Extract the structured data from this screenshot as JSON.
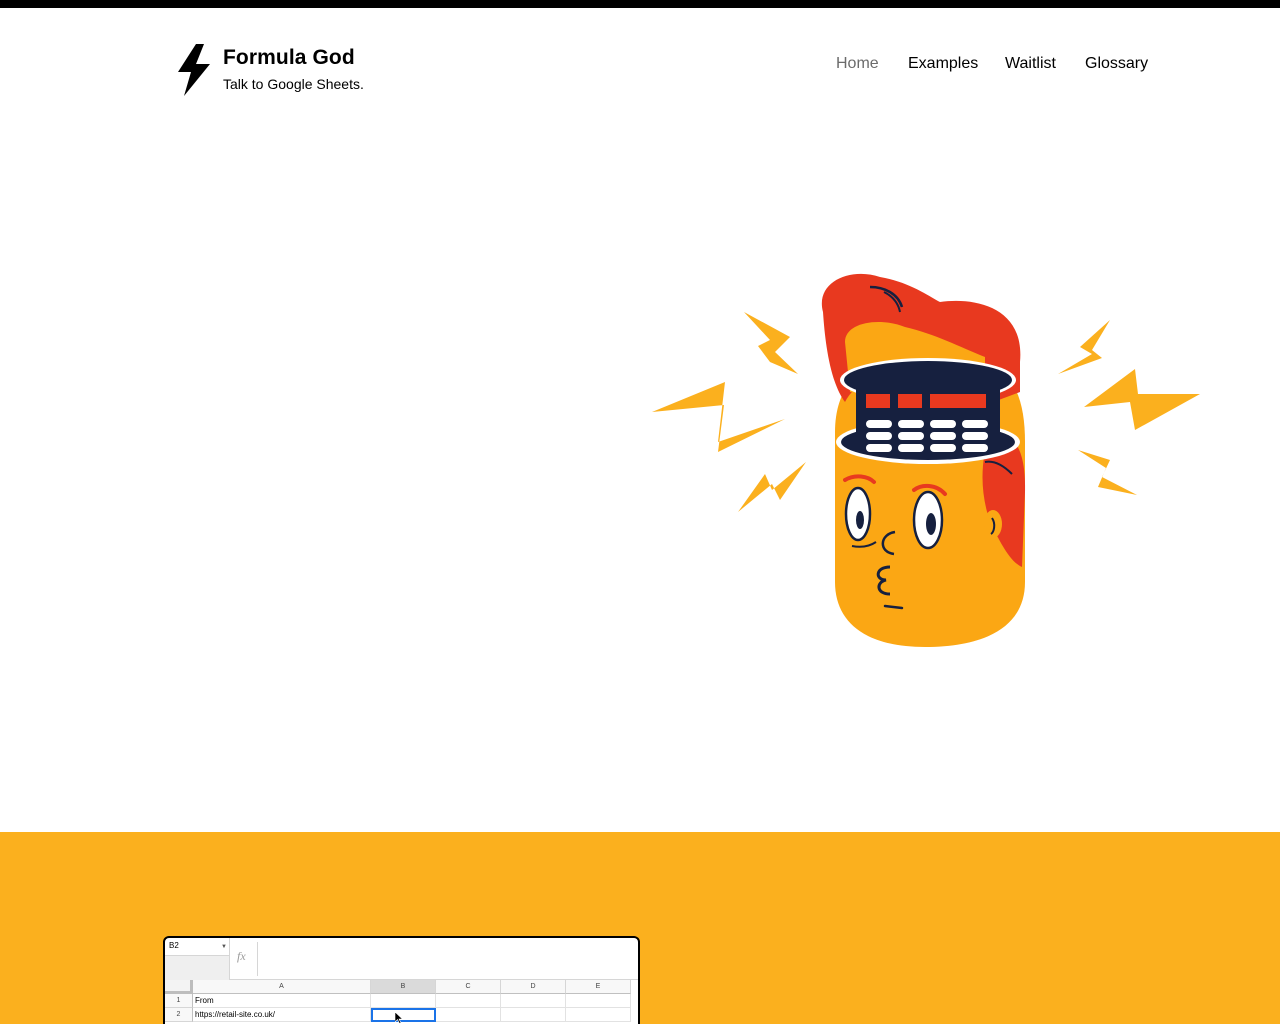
{
  "brand": {
    "name": "Formula God",
    "tagline": "Talk to Google Sheets."
  },
  "nav": {
    "items": [
      {
        "label": "Home",
        "active": true
      },
      {
        "label": "Examples",
        "active": false
      },
      {
        "label": "Waitlist",
        "active": false
      },
      {
        "label": "Glossary",
        "active": false
      }
    ]
  },
  "hero": {
    "illustration": "head-with-calculator-brain-illustration"
  },
  "band": {
    "color": "#fbb01e"
  },
  "sheet": {
    "name_box": "B2",
    "fx_symbol": "fx",
    "columns": [
      "A",
      "B",
      "C",
      "D",
      "E"
    ],
    "selected_column": "B",
    "rows": [
      {
        "num": "1",
        "cells": [
          "From",
          "",
          "",
          "",
          ""
        ]
      },
      {
        "num": "2",
        "cells": [
          "https://retail-site.co.uk/",
          "",
          "",
          "",
          ""
        ]
      }
    ],
    "selected_cell": "B2"
  },
  "colors": {
    "accent": "#fbb01e",
    "hair": "#e8391f",
    "face": "#fba714",
    "navy": "#16203f",
    "selection": "#1a73e8"
  }
}
